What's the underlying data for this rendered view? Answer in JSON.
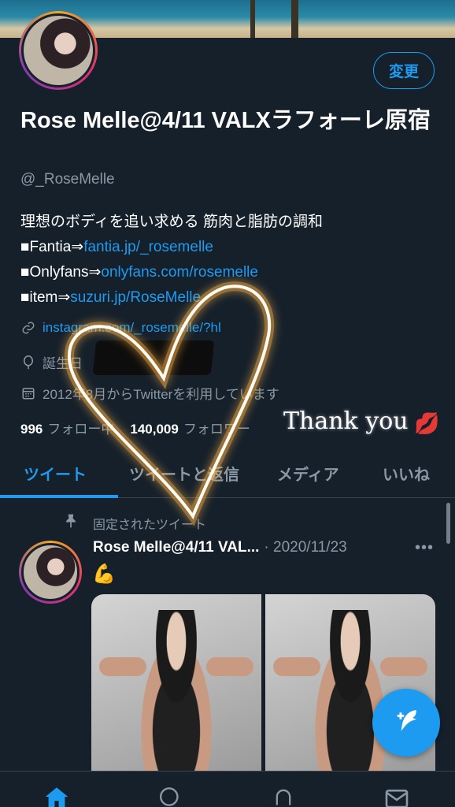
{
  "profile": {
    "name": "Rose Melle@4/11 VALXラフォーレ原宿",
    "handle": "@_RoseMelle",
    "edit_button": "変更",
    "bio": {
      "line1": "理想のボディを追い求める 筋肉と脂肪の調和",
      "line2_prefix": "■Fantia⇒",
      "line2_link": "fantia.jp/_rosemelle",
      "line3_prefix": "■Onlyfans⇒",
      "line3_link": "onlyfans.com/rosemelle",
      "line4_prefix": "■item⇒",
      "line4_link": "suzuri.jp/RoseMelle"
    },
    "website": "instagram.com/_rosemelle/?hl",
    "birthday_label": "誕生日",
    "joined": "2012年8月からTwitterを利用しています",
    "following_count": "996",
    "following_label": "フォロー中",
    "followers_count": "140,009",
    "followers_label": "フォロワー"
  },
  "overlay": {
    "thank_you": "Thank you",
    "kiss_emoji": "💋"
  },
  "tabs": [
    {
      "label": "ツイート",
      "active": true
    },
    {
      "label": "ツイートと返信",
      "active": false
    },
    {
      "label": "メディア",
      "active": false
    },
    {
      "label": "いいね",
      "active": false
    }
  ],
  "pinned_tweet": {
    "pinned_label": "固定されたツイート",
    "author": "Rose Melle@4/11 VAL...",
    "date": "· 2020/11/23",
    "more": "•••",
    "emoji": "💪"
  },
  "colors": {
    "background": "#15202b",
    "accent": "#1d9bf0",
    "secondary_text": "#8b98a5",
    "divider": "#38444d"
  },
  "icons": {
    "link": "link-icon",
    "birthday": "balloon-icon",
    "calendar": "calendar-icon",
    "pin": "pin-icon",
    "compose": "compose-tweet-icon",
    "home": "home-icon",
    "search": "search-icon",
    "notifications": "bell-icon",
    "messages": "mail-icon"
  }
}
